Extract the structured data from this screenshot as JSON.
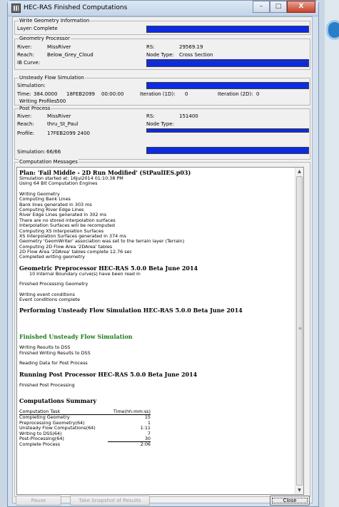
{
  "window": {
    "title": "HEC-RAS Finished Computations",
    "minimize": "–",
    "maximize": "□",
    "close": "X"
  },
  "write_geometry": {
    "legend": "Write Geometry Information",
    "label": "Layer:",
    "value": "Complete",
    "progress": 1.0
  },
  "geometry_processor": {
    "legend": "Geometry Processor",
    "river_label": "River:",
    "river": "MissRiver",
    "rs_label": "RS:",
    "rs": "29569.19",
    "reach_label": "Reach:",
    "reach": "Below_Grey_Cloud",
    "node_type_label": "Node Type:",
    "node_type": "Cross Section",
    "ib_label": "IB Curve:",
    "progress_rs": 1.0,
    "progress_ib": 1.0
  },
  "unsteady": {
    "legend": "Unsteady Flow Simulation",
    "sim_label": "Simulation:",
    "time_label": "Time:",
    "time_value": "384.0000",
    "date": "18FEB2099",
    "clock": "00:00:00",
    "iter1d_label": "Iteration (1D):",
    "iter1d": "0",
    "iter2d_label": "Iteration (2D):",
    "iter2d": "0",
    "writing_profiles_label": "Writing Profiles",
    "writing_profiles": "500",
    "progress": 1.0
  },
  "post_process": {
    "legend": "Post Process",
    "river_label": "River:",
    "river": "MissRiver",
    "rs_label": "RS:",
    "rs": "151400",
    "reach_label": "Reach:",
    "reach": "thru_St_Paul",
    "node_type_label": "Node Type:",
    "node_type": "",
    "profile_label": "Profile:",
    "profile": "17FEB2099 2400",
    "sim_label": "Simulation:",
    "sim_value": "66/66",
    "progress_profile": 1.0,
    "progress_sim": 1.0
  },
  "messages": {
    "legend": "Computation Messages",
    "plan": "Plan: 'Fail Middle - 2D Run Modified' (StPaulIES.p03)",
    "sim_started": "Simulation started at: 16Jul2014 01:10:38 PM",
    "engine": "Using 64 Bit Computation Engines",
    "geo_lines": [
      "Writing Geometry",
      "Computing Bank Lines",
      "Bank lines generated in 303 ms",
      "Computing River Edge Lines",
      "River Edge Lines generated in 302 ms",
      "There are no stored interpolation surfaces",
      "Interpolation Surfaces will be recomputed",
      "Computing XS Interpolation Surfaces",
      "XS Interpolation Surfaces generated in 374 ms",
      "Geometry 'GeomWriter' association was set to the terrain layer (Terrain)",
      "Computing 2D Flow Area '2DArea' tables",
      "2D Flow Area '2DArea' tables complete 12.76 sec",
      "Completed writing geometry"
    ],
    "geo_pre_header": "Geometric Preprocessor HEC-RAS 5.0.0 Beta June 2014",
    "ib_curves": "10 Internal Boundary curve(s) have been read in",
    "finished_geo": "Finished Processing Geometry",
    "writing_events": "Writing event conditions",
    "events_complete": "Event conditions complete",
    "unsteady_header": "Performing Unsteady Flow Simulation  HEC-RAS 5.0.0 Beta June 2014",
    "finished_unsteady": "Finished Unsteady Flow Simulation",
    "writing_dss": "Writing Results to DSS",
    "finished_dss": "Finished Writing Results to DSS",
    "reading_post": "Reading Data for Post Process",
    "post_header": "Running Post Processor  HEC-RAS 5.0.0 Beta June 2014",
    "finished_post": "Finished Post Processing",
    "summary_header": "Computations Summary",
    "summary_col1": "Computation Task",
    "summary_col2": "Time(hh:mm:ss)",
    "summary_rows": [
      {
        "task": "Completing Geometry",
        "time": "15"
      },
      {
        "task": "Preprocessing Geometry(64)",
        "time": "1"
      },
      {
        "task": "Unsteady Flow Computations(64)",
        "time": "1:11"
      },
      {
        "task": "Writing to DSS(64)",
        "time": "7"
      },
      {
        "task": "Post-Processing(64)",
        "time": "30"
      }
    ],
    "total_task": "Complete Process",
    "total_time": "2:06"
  },
  "buttons": {
    "pause": "Pause",
    "snapshot": "Take Snapshot of Results",
    "close": "Close"
  },
  "colors": {
    "progress": "#0c2be2",
    "finished_green": "#1a7a1a"
  }
}
